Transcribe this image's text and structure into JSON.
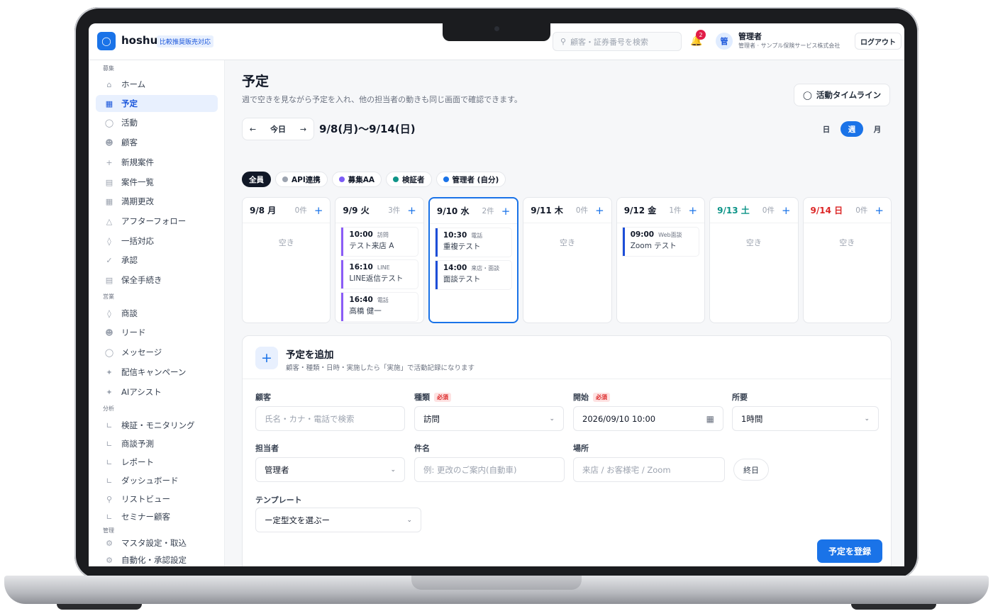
{
  "app": {
    "brand": "hoshu",
    "badge": "比較推奨販売対応"
  },
  "header": {
    "search_placeholder": "顧客・証券番号を検索",
    "notification_count": "2",
    "avatar_initial": "管",
    "user_name": "管理者",
    "user_org": "管理者 · サンプル保険サービス株式会社",
    "logout": "ログアウト"
  },
  "sidebar": {
    "sections": [
      "募集",
      "営業",
      "分析",
      "管理"
    ],
    "items": [
      {
        "label": "ホーム",
        "icon": "home-icon"
      },
      {
        "label": "予定",
        "icon": "calendar-icon"
      },
      {
        "label": "活動",
        "icon": "chat-icon"
      },
      {
        "label": "顧客",
        "icon": "users-icon"
      },
      {
        "label": "新規案件",
        "icon": "plus-icon"
      },
      {
        "label": "案件一覧",
        "icon": "document-icon"
      },
      {
        "label": "満期更改",
        "icon": "calendar-icon"
      },
      {
        "label": "アフターフォロー",
        "icon": "bell-icon"
      },
      {
        "label": "一括対応",
        "icon": "layers-icon"
      },
      {
        "label": "承認",
        "icon": "check-icon"
      },
      {
        "label": "保全手続き",
        "icon": "document-icon"
      },
      {
        "label": "商談",
        "icon": "layers-icon"
      },
      {
        "label": "リード",
        "icon": "users-icon"
      },
      {
        "label": "メッセージ",
        "icon": "chat-icon"
      },
      {
        "label": "配信キャンペーン",
        "icon": "sparkle-icon"
      },
      {
        "label": "AIアシスト",
        "icon": "sparkle-icon"
      },
      {
        "label": "検証・モニタリング",
        "icon": "chart-icon"
      },
      {
        "label": "商談予測",
        "icon": "chart-icon"
      },
      {
        "label": "レポート",
        "icon": "chart-icon"
      },
      {
        "label": "ダッシュボード",
        "icon": "chart-icon"
      },
      {
        "label": "リストビュー",
        "icon": "search-icon"
      },
      {
        "label": "セミナー顧客",
        "icon": "chart-icon"
      },
      {
        "label": "マスタ設定・取込",
        "icon": "gear-icon"
      },
      {
        "label": "自動化・承認設定",
        "icon": "gear-icon"
      }
    ]
  },
  "page": {
    "title": "予定",
    "description": "週で空きを見ながら予定を入れ、他の担当者の動きも同じ画面で確認できます。",
    "timeline_button": "活動タイムライン",
    "today": "今日",
    "range": "9/8(月)〜9/14(日)",
    "views": [
      "日",
      "週",
      "月"
    ],
    "active_view": "週"
  },
  "filters": [
    {
      "label": "全員",
      "color": ""
    },
    {
      "label": "API連携",
      "color": "#9ca3af"
    },
    {
      "label": "募集AA",
      "color": "#7c5cf6"
    },
    {
      "label": "検証者",
      "color": "#0f9488"
    },
    {
      "label": "管理者 (自分)",
      "color": "#1a73e8"
    }
  ],
  "days": [
    {
      "date": "9/8 月",
      "count": "0件",
      "empty": "空き",
      "events": []
    },
    {
      "date": "9/9 火",
      "count": "3件",
      "empty": "",
      "events": [
        {
          "time": "10:00",
          "type": "訪問",
          "title": "テスト来店 A"
        },
        {
          "time": "16:10",
          "type": "LINE",
          "title": "LINE返信テスト"
        },
        {
          "time": "16:40",
          "type": "電話",
          "title": "高橋 健一"
        }
      ]
    },
    {
      "date": "9/10 水",
      "count": "2件",
      "empty": "",
      "events": [
        {
          "time": "10:30",
          "type": "電話",
          "title": "重複テスト"
        },
        {
          "time": "14:00",
          "type": "来店・面談",
          "title": "面談テスト"
        }
      ]
    },
    {
      "date": "9/11 木",
      "count": "0件",
      "empty": "空き",
      "events": []
    },
    {
      "date": "9/12 金",
      "count": "1件",
      "empty": "",
      "events": [
        {
          "time": "09:00",
          "type": "Web面談",
          "title": "Zoom テスト"
        }
      ]
    },
    {
      "date": "9/13 土",
      "count": "0件",
      "empty": "空き",
      "events": []
    },
    {
      "date": "9/14 日",
      "count": "0件",
      "empty": "空き",
      "events": []
    }
  ],
  "form": {
    "title": "予定を追加",
    "subtitle": "顧客・種類・日時・実施したら「実施」で活動記録になります",
    "required": "必須",
    "customer_label": "顧客",
    "customer_placeholder": "氏名・カナ・電話で検索",
    "type_label": "種類",
    "type_value": "訪問",
    "start_label": "開始",
    "start_value": "2026/09/10 10:00",
    "duration_label": "所要",
    "duration_value": "1時間",
    "assignee_label": "担当者",
    "assignee_value": "管理者",
    "subject_label": "件名",
    "subject_placeholder": "例: 更改のご案内(自動車)",
    "place_label": "場所",
    "place_placeholder": "来店 / お客様宅 / Zoom",
    "allday": "終日",
    "template_label": "テンプレート",
    "template_value": "ー定型文を選ぶー",
    "submit": "予定を登録"
  }
}
